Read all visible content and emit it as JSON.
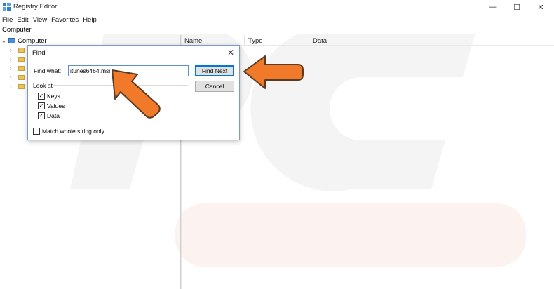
{
  "window": {
    "title": "Registry Editor",
    "controls": {
      "minimize": "—",
      "maximize": "☐",
      "close": "✕"
    }
  },
  "menu": [
    "File",
    "Edit",
    "View",
    "Favorites",
    "Help"
  ],
  "address": "Computer",
  "tree": {
    "root_label": "Computer",
    "children_count_visible": 5
  },
  "list": {
    "columns": [
      "Name",
      "Type",
      "Data"
    ]
  },
  "find_dialog": {
    "title": "Find",
    "close_glyph": "✕",
    "find_what_label": "Find what:",
    "find_what_value": "itunes6464.msi",
    "find_next_label": "Find Next",
    "cancel_label": "Cancel",
    "look_at_label": "Look at",
    "options": [
      {
        "label": "Keys",
        "checked": true
      },
      {
        "label": "Values",
        "checked": true
      },
      {
        "label": "Data",
        "checked": true
      }
    ],
    "match_whole_label": "Match whole string only",
    "match_whole_checked": false
  },
  "colors": {
    "arrow_fill": "#f07a2a",
    "arrow_stroke": "#5a3a20",
    "dialog_border": "#7a9bc4",
    "default_button_border": "#0078d7"
  },
  "icons": {
    "app": "registry-icon",
    "root": "computer-icon",
    "node": "folder-icon"
  }
}
